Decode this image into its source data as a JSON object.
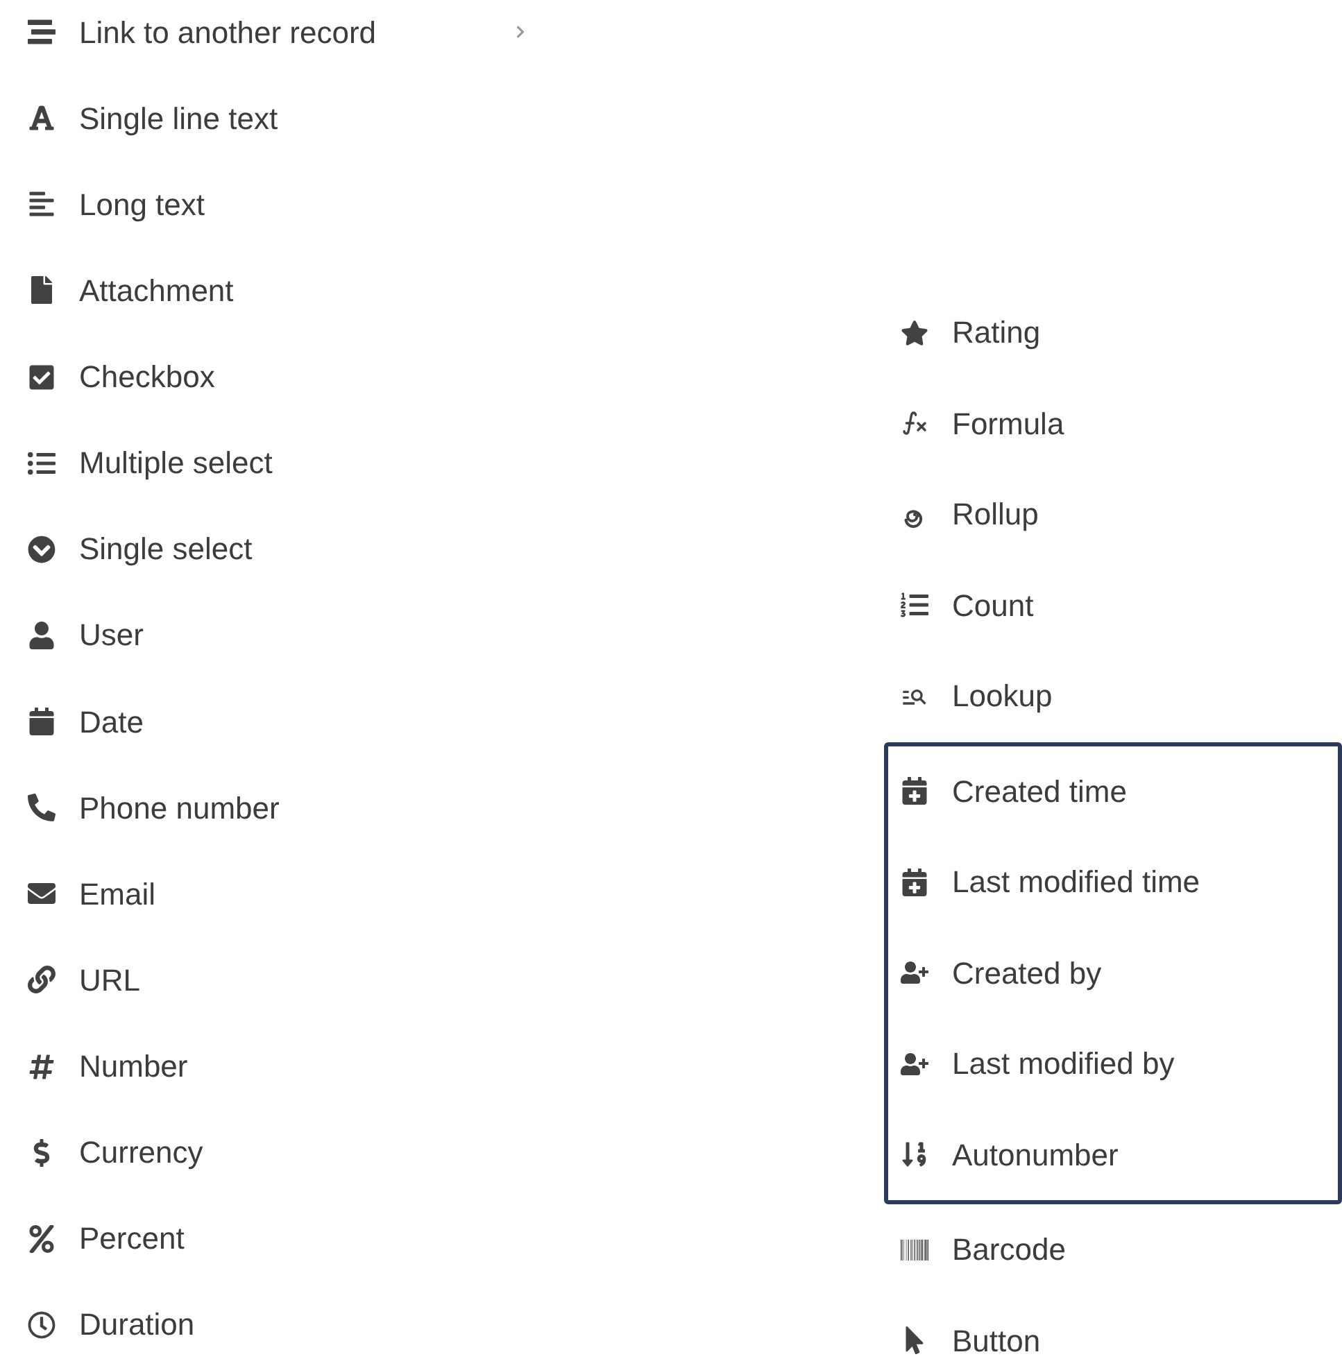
{
  "left_column": {
    "items": [
      {
        "kind": "link",
        "label": "Link to another record",
        "submenu": true
      },
      {
        "kind": "text",
        "label": "Single line text",
        "submenu": false
      },
      {
        "kind": "longtext",
        "label": "Long text",
        "submenu": false
      },
      {
        "kind": "attachment",
        "label": "Attachment",
        "submenu": false
      },
      {
        "kind": "checkbox",
        "label": "Checkbox",
        "submenu": false
      },
      {
        "kind": "multiselect",
        "label": "Multiple select",
        "submenu": false
      },
      {
        "kind": "singleselect",
        "label": "Single select",
        "submenu": false
      },
      {
        "kind": "user",
        "label": "User",
        "submenu": false
      },
      {
        "kind": "date",
        "label": "Date",
        "submenu": false
      },
      {
        "kind": "phone",
        "label": "Phone number",
        "submenu": false
      },
      {
        "kind": "email",
        "label": "Email",
        "submenu": false
      },
      {
        "kind": "url",
        "label": "URL",
        "submenu": false
      },
      {
        "kind": "number",
        "label": "Number",
        "submenu": false
      },
      {
        "kind": "currency",
        "label": "Currency",
        "submenu": false
      },
      {
        "kind": "percent",
        "label": "Percent",
        "submenu": false
      },
      {
        "kind": "duration",
        "label": "Duration",
        "submenu": false
      }
    ]
  },
  "right_column": {
    "items": [
      {
        "kind": "rating",
        "label": "Rating",
        "highlighted": false
      },
      {
        "kind": "formula",
        "label": "Formula",
        "highlighted": false
      },
      {
        "kind": "rollup",
        "label": "Rollup",
        "highlighted": false
      },
      {
        "kind": "count",
        "label": "Count",
        "highlighted": false
      },
      {
        "kind": "lookup",
        "label": "Lookup",
        "highlighted": false
      },
      {
        "kind": "createdtime",
        "label": "Created time",
        "highlighted": true
      },
      {
        "kind": "createdtime",
        "label": "Last modified time",
        "highlighted": true
      },
      {
        "kind": "createdby",
        "label": "Created by",
        "highlighted": true
      },
      {
        "kind": "createdby",
        "label": "Last modified by",
        "highlighted": true
      },
      {
        "kind": "autonumber",
        "label": "Autonumber",
        "highlighted": true
      },
      {
        "kind": "barcode",
        "label": "Barcode",
        "highlighted": false
      },
      {
        "kind": "button",
        "label": "Button",
        "highlighted": false
      }
    ]
  }
}
